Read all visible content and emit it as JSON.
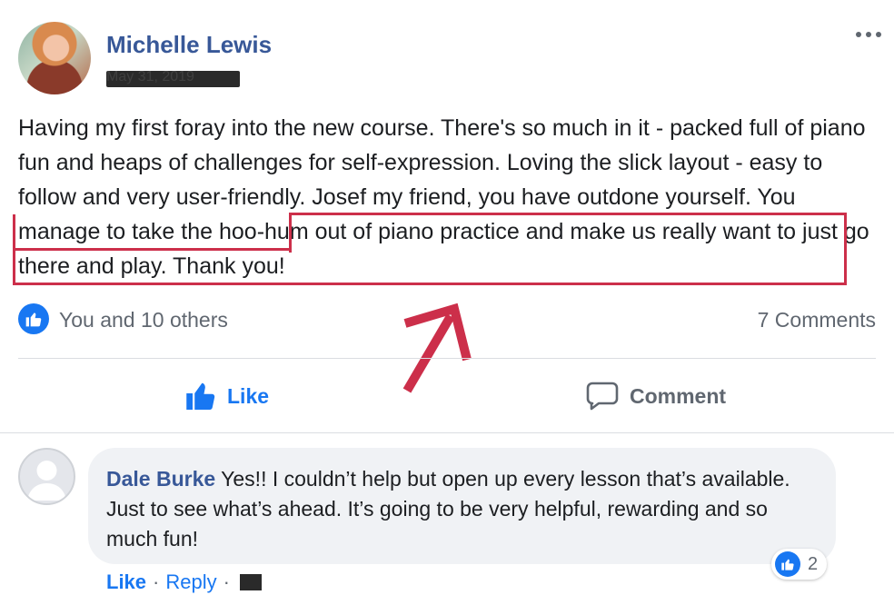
{
  "post": {
    "author": "Michelle Lewis",
    "date": "May 31, 2019",
    "text_part1": "Having my first foray into the new course. There's so much in it - packed full of piano fun and heaps of challenges for self-expression. Loving the slick layout - easy to follow and very user-friendly. Josef my friend, you have outdone yourself. ",
    "text_highlighted": "You manage to take the hoo-hum out of piano practice and make us really want to just go there and play. Thank you!"
  },
  "reactions": {
    "summary": "You and 10 others",
    "comments_count": "7 Comments"
  },
  "actions": {
    "like_label": "Like",
    "comment_label": "Comment"
  },
  "comment": {
    "author": "Dale Burke",
    "text": "Yes!! I couldn’t help but open up every lesson that’s available. Just to see what’s ahead. It’s going to be very helpful, rewarding and so much fun!",
    "like_count": "2",
    "like_label": "Like",
    "separator": "·",
    "reply_label": "Reply"
  },
  "colors": {
    "accent_blue": "#1877f2",
    "name_blue": "#385898",
    "annotation_red": "#cc2f4a"
  },
  "icons": {
    "more": "more-dots-icon",
    "like": "thumbs-up-icon",
    "comment": "speech-bubble-icon"
  }
}
